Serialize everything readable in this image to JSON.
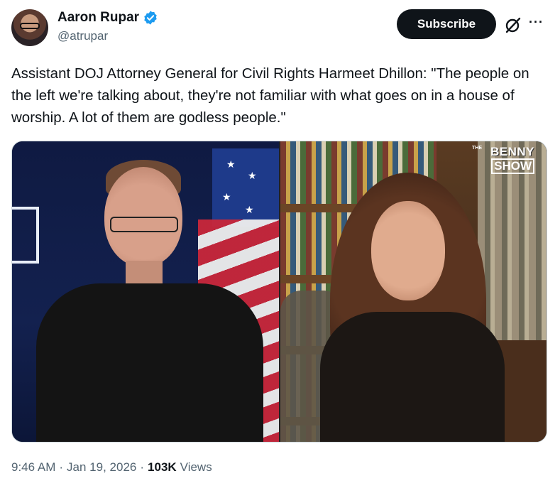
{
  "author": {
    "display_name": "Aaron Rupar",
    "handle": "@atrupar",
    "verified": true,
    "verified_color": "#1d9bf0"
  },
  "actions": {
    "subscribe_label": "Subscribe",
    "more_label": "···"
  },
  "tweet": {
    "text": "Assistant DOJ Attorney General for Civil Rights Harmeet Dhillon: \"The people on the left we're talking about, they're not familiar with what goes on in a house of worship. A lot of them are godless people.\""
  },
  "media": {
    "watermark_small": "THE",
    "watermark_line1": "BENNY",
    "watermark_line2": "SHOW"
  },
  "meta": {
    "time": "9:46 AM",
    "separator": "·",
    "date": "Jan 19, 2026",
    "views_count": "103K",
    "views_label": "Views"
  }
}
